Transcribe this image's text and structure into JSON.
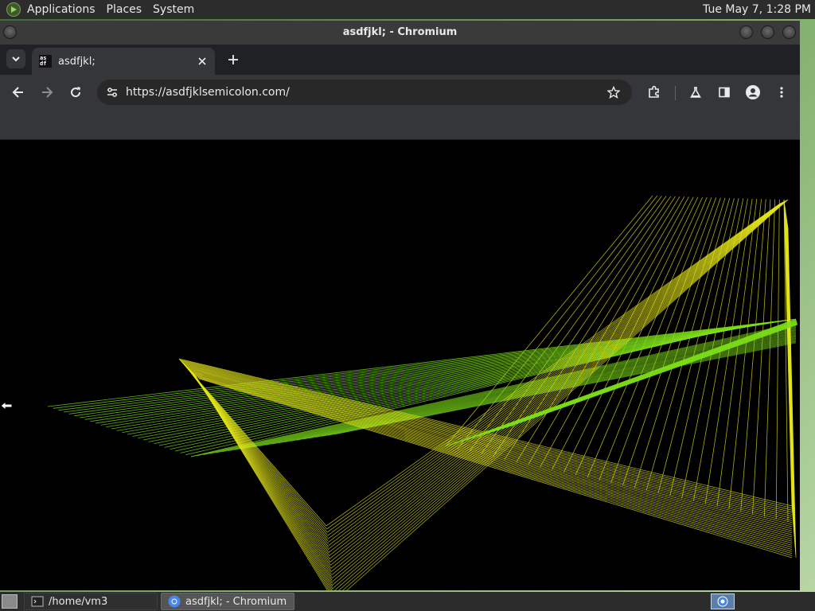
{
  "top_panel": {
    "menus": [
      "Applications",
      "Places",
      "System"
    ],
    "clock": "Tue May  7,  1:28 PM"
  },
  "window": {
    "title": "asdfjkl; - Chromium"
  },
  "browser": {
    "tab": {
      "title": "asdfjkl;",
      "favicon_text": "as df"
    },
    "url": "https://asdfjklsemicolon.com/"
  },
  "taskbar": {
    "items": [
      {
        "label": "/home/vm3",
        "icon": "terminal-icon"
      },
      {
        "label": "asdfjkl; - Chromium",
        "icon": "chromium-icon"
      }
    ]
  },
  "colors": {
    "line_green": "#7ee01a",
    "line_yellow": "#e5e51c",
    "page_bg": "#000000",
    "chrome_dark": "#35363a"
  }
}
